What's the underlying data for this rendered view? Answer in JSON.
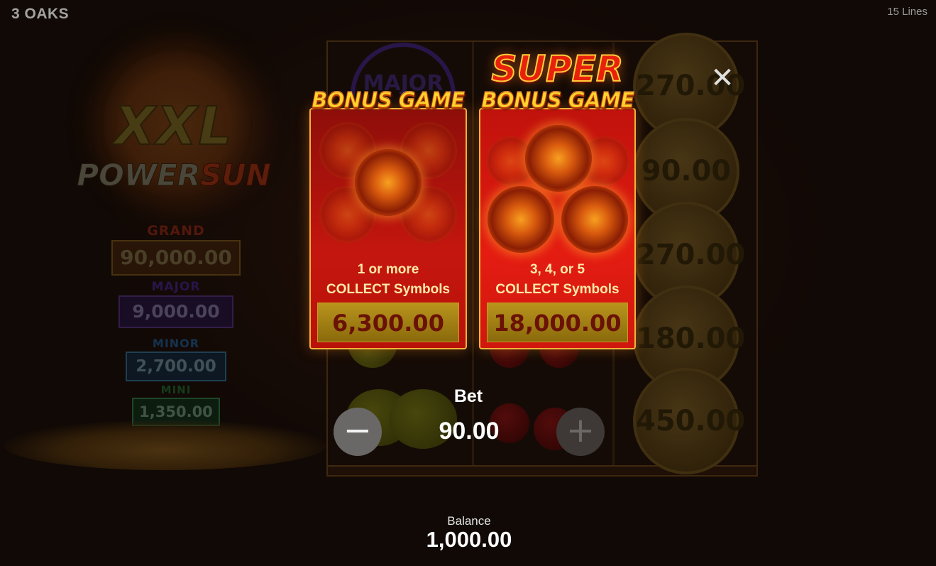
{
  "header": {
    "brand": "3 OAKS",
    "lines": "15 Lines"
  },
  "logo": {
    "line1": "XXL",
    "line2a": "POWER",
    "line2b": "SUN"
  },
  "jackpots": [
    {
      "name": "GRAND",
      "value": "90,000.00"
    },
    {
      "name": "MAJOR",
      "value": "9,000.00"
    },
    {
      "name": "MINOR",
      "value": "2,700.00"
    },
    {
      "name": "MINI",
      "value": "1,350.00"
    }
  ],
  "reels": {
    "major_symbol": "MAJOR",
    "coin_values": [
      "270.00",
      "90.00",
      "270.00",
      "180.00",
      "450.00"
    ]
  },
  "bonus_popup": {
    "bonus_game": {
      "title": "BONUS GAME",
      "condition_line1": "1 or more",
      "condition_line2": "COLLECT Symbols",
      "value": "6,300.00"
    },
    "super_bonus_game": {
      "title_super": "SUPER",
      "title": "BONUS GAME",
      "condition_line1": "3, 4, or 5",
      "condition_line2": "COLLECT Symbols",
      "value": "18,000.00"
    },
    "close_icon": "close-icon"
  },
  "bet": {
    "label": "Bet",
    "value": "90.00",
    "minus_icon": "minus-icon",
    "plus_icon": "plus-icon"
  },
  "balance": {
    "label": "Balance",
    "value": "1,000.00"
  },
  "colors": {
    "gold": "#ffd22e",
    "card_red": "#c4160e",
    "card_border": "#f2b23a"
  }
}
